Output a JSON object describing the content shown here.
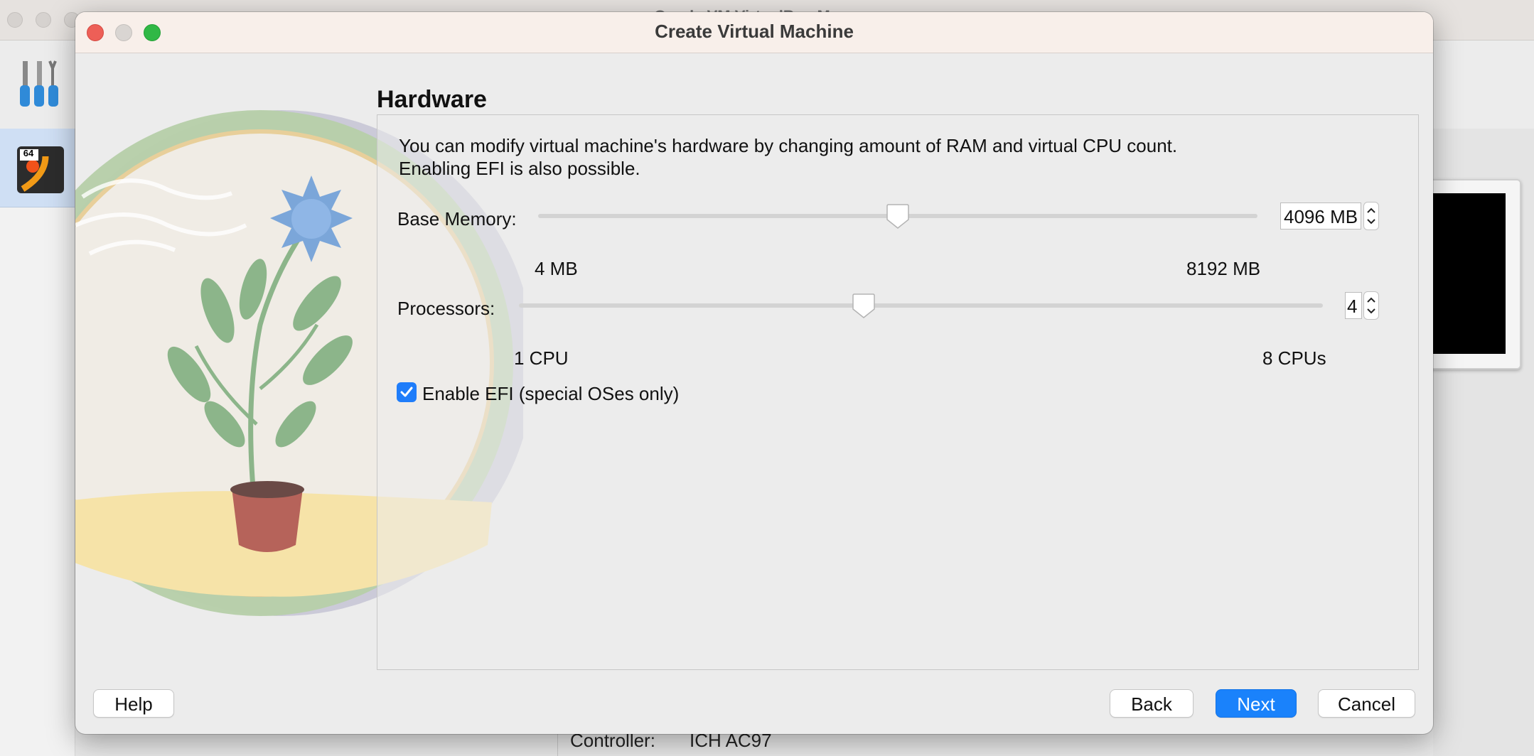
{
  "background": {
    "window_title": "Oracle VM VirtualBox Manager",
    "vm_badge": "64",
    "details": {
      "controller_label": "Controller:",
      "controller_value": "ICH AC97"
    }
  },
  "dialog": {
    "title": "Create Virtual Machine",
    "section_title": "Hardware",
    "description_line1": "You can modify virtual machine's hardware by changing amount of RAM and virtual CPU count.",
    "description_line2": "Enabling EFI is also possible.",
    "memory": {
      "label": "Base Memory:",
      "value": "4096 MB",
      "min_label": "4 MB",
      "max_label": "8192 MB",
      "min": 4,
      "max": 8192,
      "current": 4096
    },
    "processors": {
      "label": "Processors:",
      "value": "4",
      "min_label": "1 CPU",
      "max_label": "8 CPUs",
      "min": 1,
      "max": 8,
      "current": 4
    },
    "efi": {
      "label": "Enable EFI (special OSes only)",
      "checked": true
    },
    "buttons": {
      "help": "Help",
      "back": "Back",
      "next": "Next",
      "cancel": "Cancel"
    }
  },
  "colors": {
    "accent": "#1a82fb",
    "close": "#ed5f57",
    "minimize": "#c9c6c4",
    "zoom": "#30b846"
  }
}
